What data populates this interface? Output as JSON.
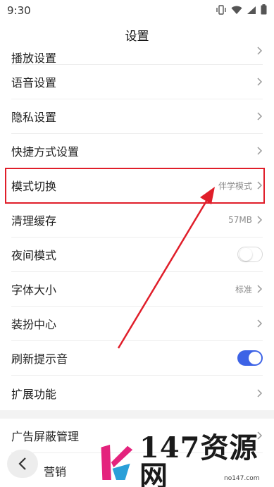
{
  "status_bar": {
    "time": "9:30"
  },
  "header": {
    "title": "设置"
  },
  "settings": {
    "partial_row": {
      "label": "播放设置"
    },
    "rows": [
      {
        "label": "语音设置",
        "value": ""
      },
      {
        "label": "隐私设置",
        "value": ""
      },
      {
        "label": "快捷方式设置",
        "value": ""
      },
      {
        "label": "模式切换",
        "value": "伴学模式"
      },
      {
        "label": "清理缓存",
        "value": "57MB"
      },
      {
        "label": "夜间模式",
        "toggle": false
      },
      {
        "label": "字体大小",
        "value": "标准"
      },
      {
        "label": "装扮中心",
        "value": ""
      },
      {
        "label": "刷新提示音",
        "toggle": true
      },
      {
        "label": "扩展功能",
        "value": ""
      }
    ],
    "rows2": [
      {
        "label": "广告屏蔽管理"
      },
      {
        "label": "营销"
      }
    ]
  },
  "watermark": {
    "text": "147资源网",
    "sub": "no147.com"
  },
  "colors": {
    "accent": "#3d63e6",
    "highlight": "#e01e2a"
  }
}
